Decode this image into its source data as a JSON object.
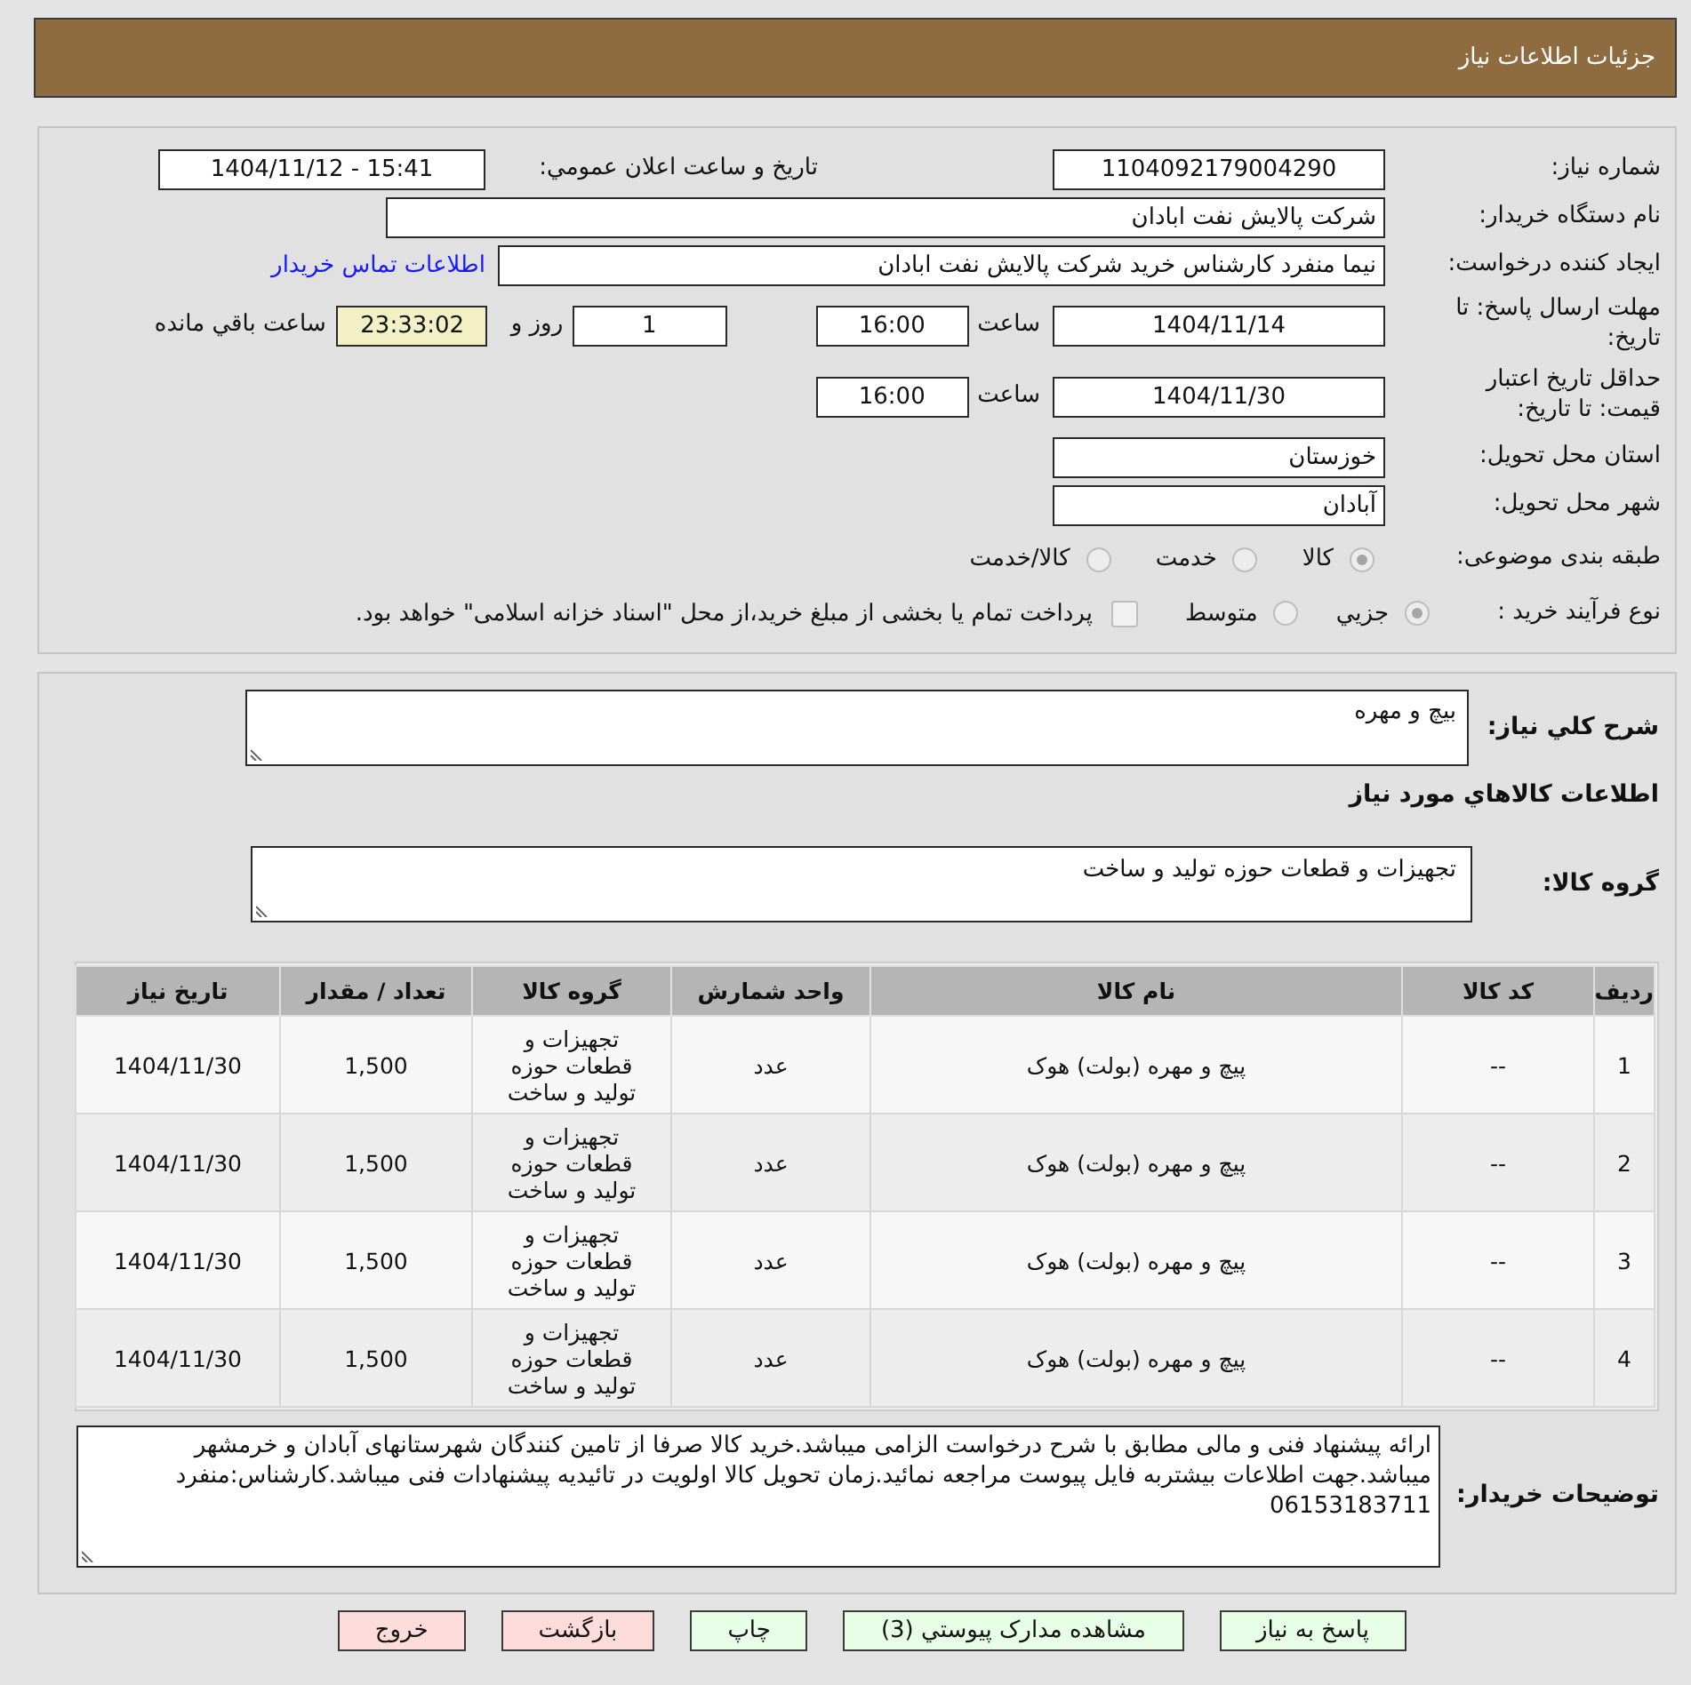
{
  "header": {
    "title": "جزئیات اطلاعات نیاز"
  },
  "details": {
    "need_number": {
      "label": "شماره نیاز:",
      "value": "1104092179004290"
    },
    "announcement": {
      "label": "تاریخ و ساعت اعلان عمومي:",
      "value": "1404/11/12 - 15:41"
    },
    "buyer_org": {
      "label": "نام دستگاه خریدار:",
      "value": "شرکت پالایش نفت ابادان"
    },
    "requester": {
      "label": "ایجاد کننده درخواست:",
      "value": "نیما منفرد کارشناس خرید شرکت پالایش نفت ابادان",
      "link": "اطلاعات تماس خریدار"
    },
    "response_deadline": {
      "label": "مهلت ارسال پاسخ: تا تاریخ:",
      "date": "1404/11/14",
      "time_label": "ساعت",
      "time": "16:00",
      "days": "1",
      "days_label": "روز و",
      "remaining": "23:33:02",
      "remaining_label": "ساعت باقي مانده"
    },
    "price_validity": {
      "label": "حداقل تاریخ اعتبار قیمت: تا تاریخ:",
      "date": "1404/11/30",
      "time_label": "ساعت",
      "time": "16:00"
    },
    "province": {
      "label": "استان محل تحویل:",
      "value": "خوزستان"
    },
    "city": {
      "label": "شهر محل تحویل:",
      "value": "آبادان"
    },
    "category": {
      "label": "طبقه بندی موضوعی:",
      "options": [
        {
          "label": "کالا",
          "selected": true
        },
        {
          "label": "خدمت",
          "selected": false
        },
        {
          "label": "کالا/خدمت",
          "selected": false
        }
      ]
    },
    "process": {
      "label": "نوع فرآیند خرید :",
      "options": [
        {
          "label": "جزيي",
          "selected": true
        },
        {
          "label": "متوسط",
          "selected": false
        }
      ],
      "treasury": {
        "label": "پرداخت تمام یا بخشی از مبلغ خرید،از محل \"اسناد خزانه اسلامی\" خواهد بود.",
        "checked": false
      }
    }
  },
  "summary": {
    "label": "شرح كلي نياز:",
    "value": "بیچ و مهره"
  },
  "goods_heading": "اطلاعات كالاهاي مورد نياز",
  "goods_group": {
    "label": "گروه كالا:",
    "value": "تجهیزات و قطعات حوزه تولید و ساخت"
  },
  "table": {
    "columns": [
      "ردیف",
      "کد کالا",
      "نام کالا",
      "واحد شمارش",
      "گروه کالا",
      "تعداد / مقدار",
      "تاریخ نیاز"
    ],
    "rows": [
      [
        "1",
        "--",
        "پیچ و مهره (بولت) هوک",
        "عدد",
        "تجهیزات و قطعات حوزه تولید و ساخت",
        "1,500",
        "1404/11/30"
      ],
      [
        "2",
        "--",
        "پیچ و مهره (بولت) هوک",
        "عدد",
        "تجهیزات و قطعات حوزه تولید و ساخت",
        "1,500",
        "1404/11/30"
      ],
      [
        "3",
        "--",
        "پیچ و مهره (بولت) هوک",
        "عدد",
        "تجهیزات و قطعات حوزه تولید و ساخت",
        "1,500",
        "1404/11/30"
      ],
      [
        "4",
        "--",
        "پیچ و مهره (بولت) هوک",
        "عدد",
        "تجهیزات و قطعات حوزه تولید و ساخت",
        "1,500",
        "1404/11/30"
      ]
    ]
  },
  "remarks": {
    "label": "توضیحات خریدار:",
    "value": "ارائه پیشنهاد فنی و مالی مطابق با شرح درخواست الزامی میباشد.خرید کالا صرفا از تامین کنندگان شهرستانهای آبادان و خرمشهر میباشد.جهت اطلاعات بیشتربه فایل پیوست مراجعه نمائید.زمان تحویل کالا اولویت در تائیدیه پیشنهادات فنی میباشد.کارشناس:منفرد 06153183711"
  },
  "buttons": [
    {
      "label": "پاسخ به نیاز",
      "kind": "positive"
    },
    {
      "label": "مشاهده مدارک پیوستي (3)",
      "kind": "positive"
    },
    {
      "label": "چاپ",
      "kind": "positive"
    },
    {
      "label": "بازگشت",
      "kind": "negative"
    },
    {
      "label": "خروج",
      "kind": "negative"
    }
  ]
}
